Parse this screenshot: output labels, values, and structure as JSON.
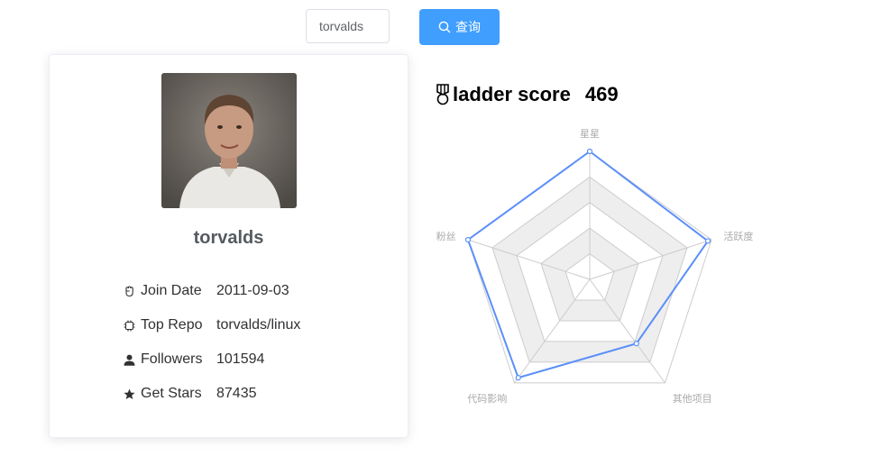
{
  "search": {
    "value": "torvalds",
    "button_label": "查询"
  },
  "profile": {
    "username": "torvalds",
    "info": [
      {
        "icon": "fist-icon",
        "label": "Join Date",
        "value": "2011-09-03"
      },
      {
        "icon": "chip-icon",
        "label": "Top Repo",
        "value": "torvalds/linux"
      },
      {
        "icon": "user-icon",
        "label": "Followers",
        "value": "101594"
      },
      {
        "icon": "star-icon",
        "label": "Get Stars",
        "value": "87435"
      }
    ]
  },
  "ladder": {
    "label": "ladder score",
    "score": "469",
    "icon": "medal-icon"
  },
  "chart_data": {
    "type": "radar",
    "indicators": [
      "星星",
      "活跃度",
      "其他项目",
      "代码影响",
      "粉丝"
    ],
    "values": [
      1.0,
      0.97,
      0.62,
      0.95,
      1.0
    ],
    "max": 1,
    "levels": 5,
    "series_color": "#5b8ff9"
  }
}
